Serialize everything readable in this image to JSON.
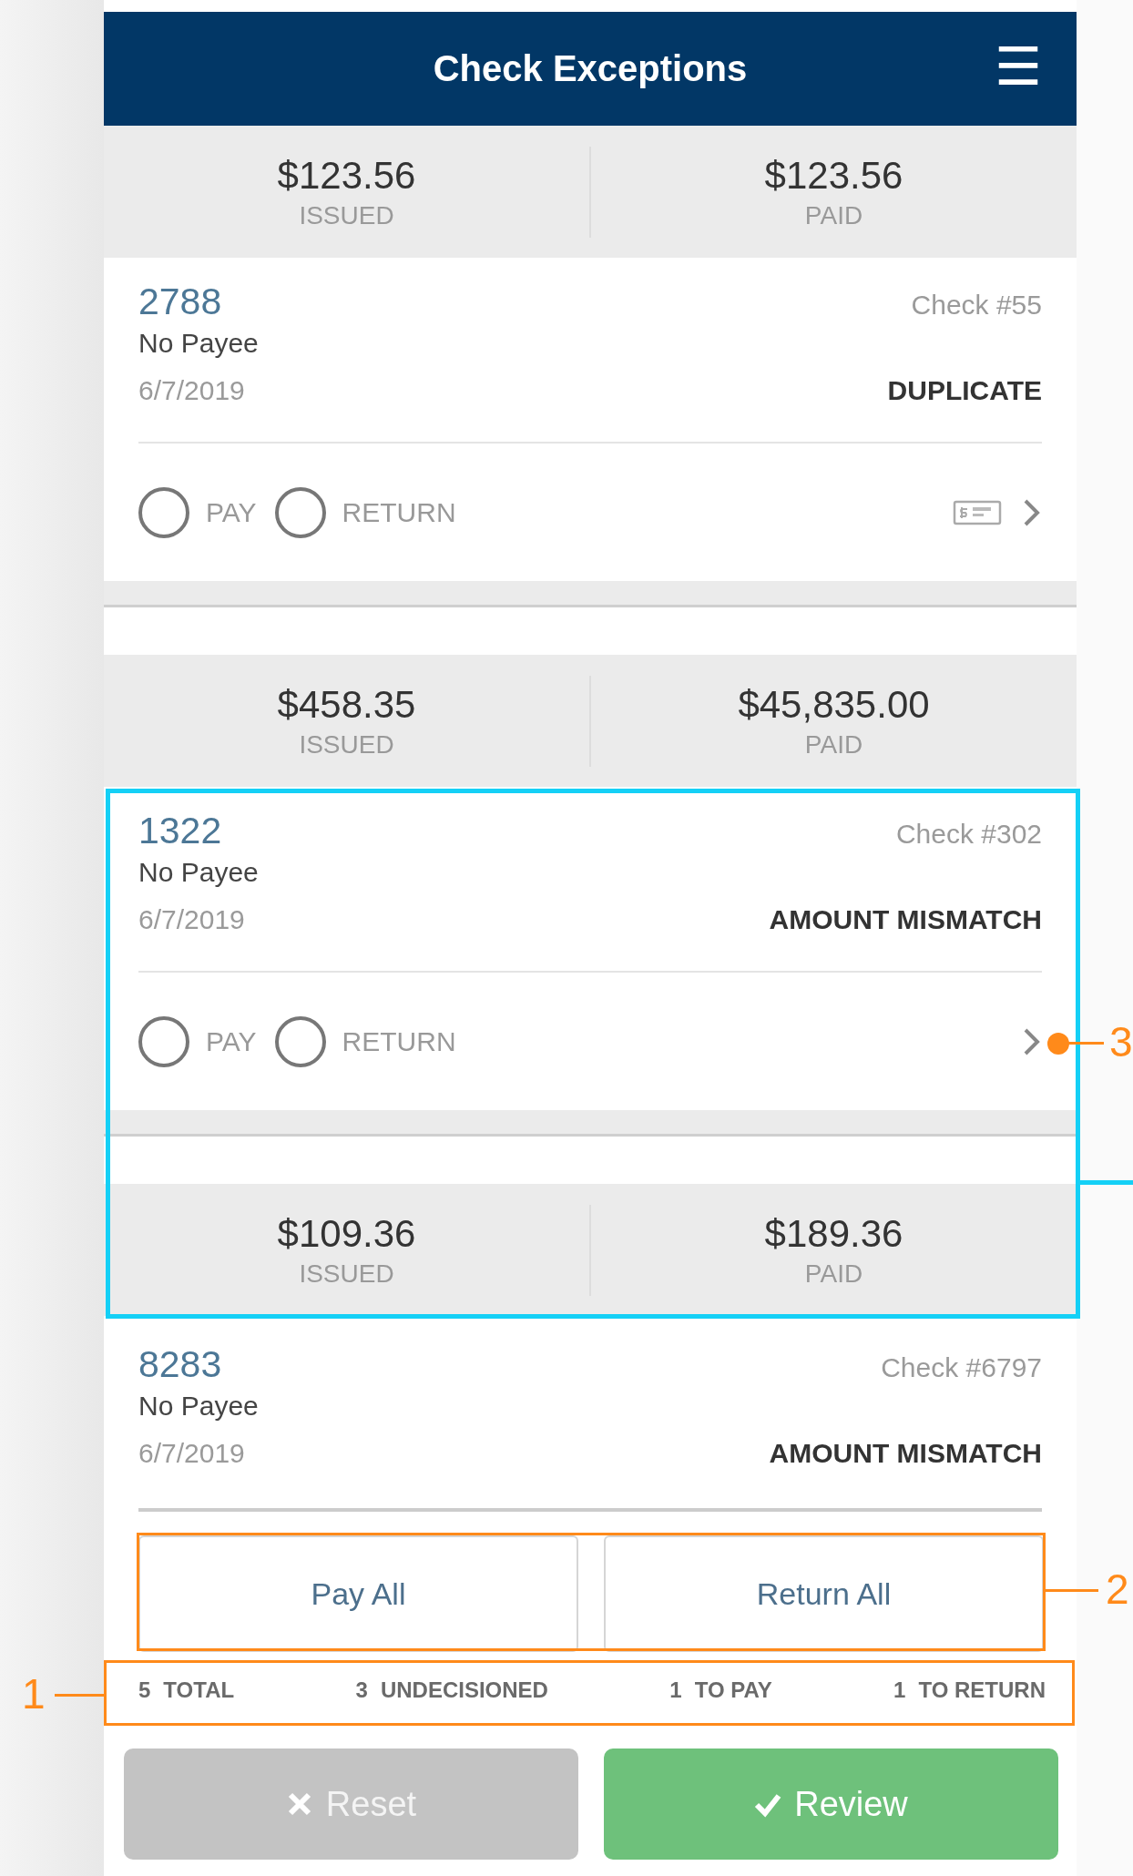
{
  "header": {
    "title": "Check Exceptions",
    "menu_icon": "☰"
  },
  "groups": [
    {
      "summary": [
        {
          "amount": "$123.56",
          "label": "ISSUED"
        },
        {
          "amount": "$123.56",
          "label": "PAID"
        }
      ],
      "item": {
        "id": "2788",
        "check": "Check #55",
        "payee": "No Payee",
        "date": "6/7/2019",
        "status": "DUPLICATE",
        "attachment": true,
        "options": [
          {
            "label": "PAY",
            "selected": false
          },
          {
            "label": "RETURN",
            "selected": false
          }
        ]
      }
    },
    {
      "summary": [
        {
          "amount": "$458.35",
          "label": "ISSUED"
        },
        {
          "amount": "$45,835.00",
          "label": "PAID"
        }
      ],
      "item": {
        "id": "1322",
        "check": "Check #302",
        "payee": "No Payee",
        "date": "6/7/2019",
        "status": "AMOUNT MISMATCH",
        "attachment": false,
        "options": [
          {
            "label": "PAY",
            "selected": false
          },
          {
            "label": "RETURN",
            "selected": false
          }
        ]
      }
    },
    {
      "summary": [
        {
          "amount": "$109.36",
          "label": "ISSUED"
        },
        {
          "amount": "$189.36",
          "label": "PAID"
        }
      ],
      "item": {
        "id": "8283",
        "check": "Check #6797",
        "payee": "No Payee",
        "date": "6/7/2019",
        "status": "AMOUNT MISMATCH"
      }
    }
  ],
  "bulk_buttons": [
    {
      "label": "Pay All"
    },
    {
      "label": "Return All"
    }
  ],
  "counts": [
    {
      "number": "5",
      "label": "TOTAL"
    },
    {
      "number": "3",
      "label": "UNDECISIONED"
    },
    {
      "number": "1",
      "label": "TO PAY"
    },
    {
      "number": "1",
      "label": "TO RETURN"
    }
  ],
  "actions": [
    {
      "kind": "reset",
      "label": "Reset",
      "disabled": true
    },
    {
      "kind": "review",
      "label": "Review",
      "disabled": false
    }
  ],
  "annotations": [
    {
      "label": "1"
    },
    {
      "label": "2"
    },
    {
      "label": "3"
    }
  ]
}
